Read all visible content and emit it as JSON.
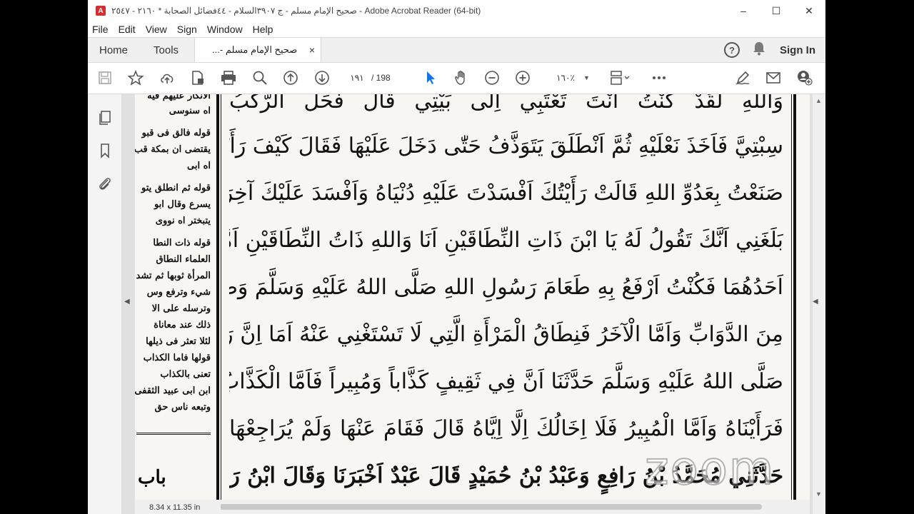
{
  "window": {
    "title": "صحيح الإمام مسلم - ج ٣٩٠٧السلام - ٤٤فضائل الصحابة * ٢١٦٠ - ٢٥٤٧ - Adobe Acrobat Reader (64-bit)",
    "minimize": "–",
    "maximize": "☐",
    "close": "✕"
  },
  "menu": [
    "File",
    "Edit",
    "View",
    "Sign",
    "Window",
    "Help"
  ],
  "tabs": {
    "home": "Home",
    "tools": "Tools",
    "document": "صحيح الإمام مسلم -...",
    "close": "×",
    "help": "?",
    "signin": "Sign In"
  },
  "toolbar": {
    "current_page": "١٩١",
    "total_pages": "/ 198",
    "zoom": "١٦٠٪"
  },
  "page": {
    "margin_notes": [
      "الانكار عليهم فيه",
      "اه سنوسى",
      "قوله فالق فى قبو",
      "يقتضى ان بمكة قب",
      "اه ابى",
      "قوله ثم انطلق يتو",
      "يسرع وقال ابو",
      "يتبختر اه نووى",
      "قوله ذات النطا",
      "العلماء النطاق",
      "المرأة ثوبها ثم تشد",
      "شيء وترفع وس",
      "وترسله على الا",
      "ذلك عند معاناة",
      "لئلا تعثر فى ذيلها",
      "قولها فاما الكذاب",
      "تعنى بالكذاب",
      "ابن ابى عبيد الثقفى",
      "وتبعه ناس حق"
    ],
    "bab": "باب",
    "main_lines": [
      "وَاللهِ لَقَدْ كُنْتُ اَنْتَ تَعْتَبِي اِلَى بَيْتِي قَالَ فَحَلَّ الرَّكْبُ",
      "سِبْتِيَّ فَاَخَذَ نَعْلَيْهِ ثُمَّ اَنْطَلَقَ يَتَوَذَّفُ حَتّٰى دَخَلَ عَلَيْهَا فَقَالَ كَيْفَ رَأَيْتِنِي",
      "صَنَعْتُ بِعَدُوِّ اللهِ قَالَتْ رَأَيْتُكَ اَفْسَدْتَ عَلَيْهِ دُنْيَاهُ وَاَفْسَدَ عَلَيْكَ آخِرَتَكَ",
      "بَلَغَنِي اَنَّكَ تَقُولُ لَهُ يَا ابْنَ ذَاتِ النِّطَاقَيْنِ اَنَا وَاللهِ ذَاتُ النِّطَاقَيْنِ اَمَّا",
      "اَحَدُهُمَا فَكُنْتُ اَرْفَعُ بِهِ طَعَامَ رَسُولِ اللهِ صَلَّى اللهُ عَلَيْهِ وَسَلَّمَ وَطَعَامَ اَبِي بَكْرٍ",
      "مِنَ الدَّوَابِّ وَاَمَّا الْآخَرُ فَنِطَاقُ الْمَرْأَةِ الَّتِي لَا تَسْتَغْنِي عَنْهُ اَمَا اِنَّ رَسُولَ اللهِ",
      "صَلَّى اللهُ عَلَيْهِ وَسَلَّمَ حَدَّثَنَا اَنَّ فِي ثَقِيفٍ كَذَّاباً وَمُبِيراً فَاَمَّا الْكَذَّابُ",
      "فَرَأَيْنَاهُ وَاَمَّا الْمُبِيرُ فَلَا اِخَالُكَ اِلَّا اِيَّاهُ قَالَ فَقَامَ عَنْهَا وَلَمْ يُرَاجِعْهَا",
      "حَدَّثَنِي مُحَمَّدُ بْنُ رَافِعٍ وَعَبْدُ بْنُ حُمَيْدٍ قَالَ عَبْدٌ اَخْبَرَنَا وَقَالَ ابْنُ رَافِعٍ حَدَّثَنَا"
    ]
  },
  "status": {
    "page_size": "8.34 x 11.35 in"
  },
  "watermark": "zoom"
}
